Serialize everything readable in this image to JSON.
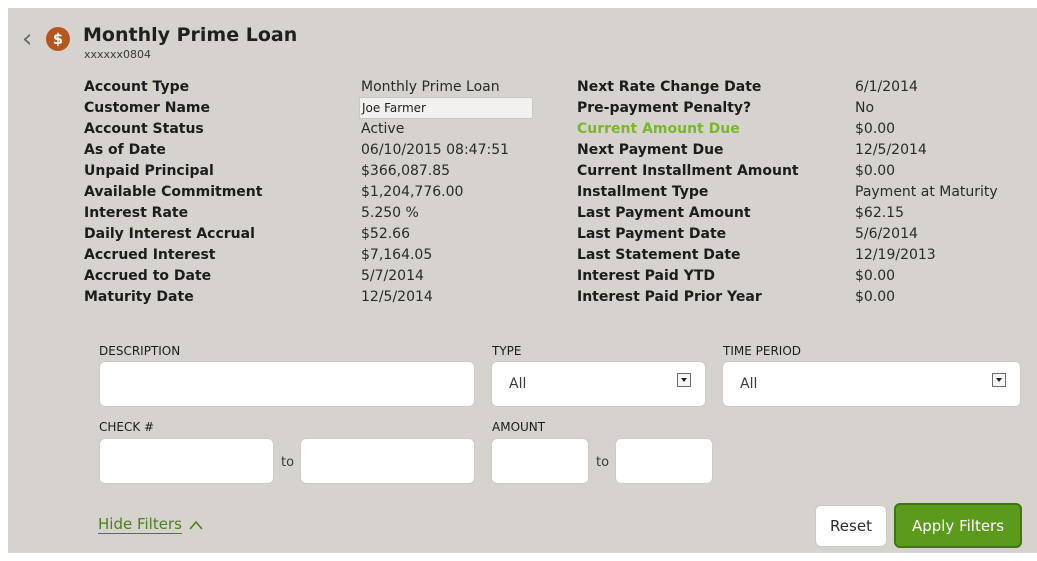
{
  "header": {
    "title": "Monthly Prime Loan",
    "account_number": "xxxxxx0804",
    "back_icon": "chevron-left-icon",
    "account_icon": "dollar-coin-icon",
    "coin_glyph": "$"
  },
  "details_left": [
    {
      "label": "Account Type",
      "value": "Monthly Prime Loan"
    },
    {
      "label": "Customer Name",
      "value": "Joe Farmer"
    },
    {
      "label": "Account Status",
      "value": "Active"
    },
    {
      "label": "As of Date",
      "value": "06/10/2015 08:47:51"
    },
    {
      "label": "Unpaid Principal",
      "value": "$366,087.85"
    },
    {
      "label": "Available Commitment",
      "value": "$1,204,776.00"
    },
    {
      "label": "Interest Rate",
      "value": "5.250 %"
    },
    {
      "label": "Daily Interest Accrual",
      "value": "$52.66"
    },
    {
      "label": "Accrued Interest",
      "value": "$7,164.05"
    },
    {
      "label": "Accrued to Date",
      "value": "5/7/2014"
    },
    {
      "label": "Maturity Date",
      "value": "12/5/2014"
    }
  ],
  "details_right": [
    {
      "label": "Next Rate Change Date",
      "value": "6/1/2014"
    },
    {
      "label": "Pre-payment Penalty?",
      "value": "No"
    },
    {
      "label": "Current Amount Due",
      "value": "$0.00"
    },
    {
      "label": "Next Payment Due",
      "value": "12/5/2014"
    },
    {
      "label": "Current Installment Amount",
      "value": "$0.00"
    },
    {
      "label": "Installment Type",
      "value": "Payment at Maturity"
    },
    {
      "label": "Last Payment Amount",
      "value": "$62.15"
    },
    {
      "label": "Last Payment Date",
      "value": "5/6/2014"
    },
    {
      "label": "Last Statement Date",
      "value": "12/19/2013"
    },
    {
      "label": "Interest Paid YTD",
      "value": "$0.00"
    },
    {
      "label": "Interest Paid Prior Year",
      "value": "$0.00"
    }
  ],
  "filters": {
    "description_label": "DESCRIPTION",
    "description_value": "",
    "type_label": "TYPE",
    "type_value": "All",
    "time_period_label": "TIME PERIOD",
    "time_period_value": "All",
    "check_label": "CHECK #",
    "check_from": "",
    "check_to": "",
    "amount_label": "AMOUNT",
    "amount_from": "",
    "amount_to": "",
    "to_text": "to"
  },
  "actions": {
    "hide_filters": "Hide Filters",
    "reset": "Reset",
    "apply": "Apply Filters"
  },
  "colors": {
    "panel": "#d6d2cd",
    "accent_green": "#5c9a1c",
    "due_green": "#7ab72e",
    "coin": "#b4571e"
  }
}
